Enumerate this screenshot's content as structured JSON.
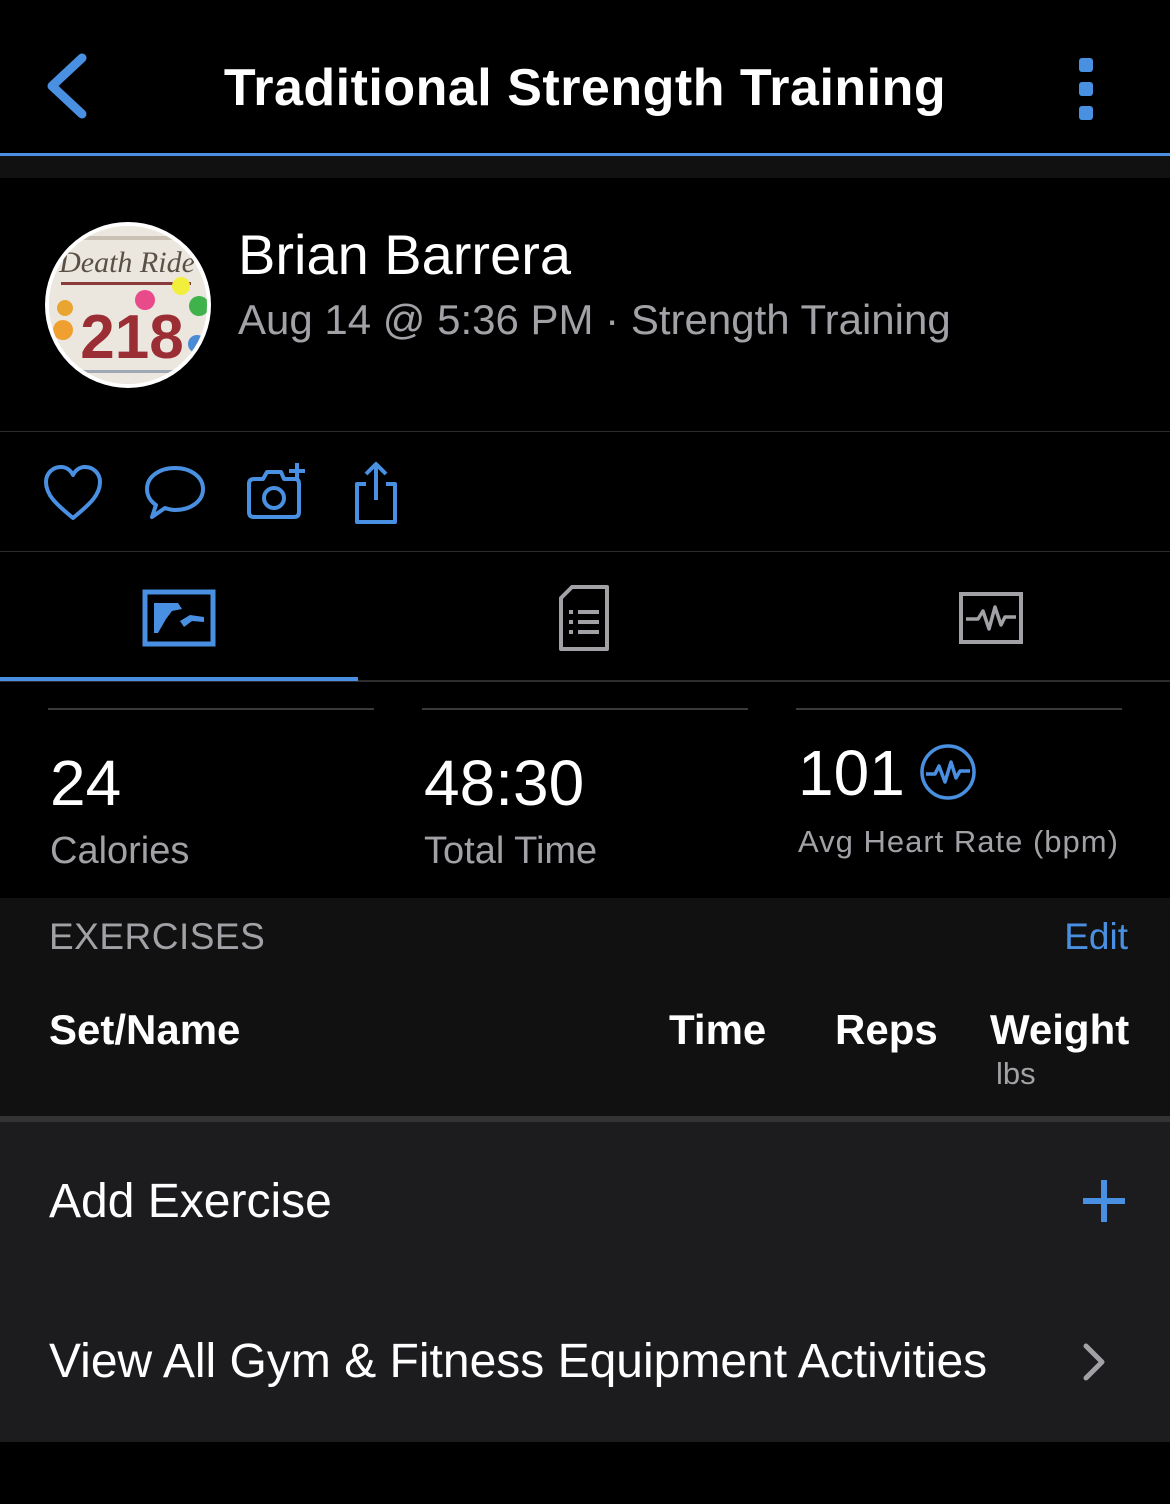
{
  "header": {
    "title": "Traditional Strength Training"
  },
  "profile": {
    "name": "Brian Barrera",
    "meta": "Aug 14 @ 5:36 PM · Strength Training",
    "avatar_text": {
      "top": "Death Ride",
      "number": "218"
    }
  },
  "actions": [
    "like-icon",
    "comment-icon",
    "add-photo-icon",
    "share-icon"
  ],
  "tabs": [
    "stats-tab-icon",
    "details-tab-icon",
    "chart-tab-icon"
  ],
  "stats": [
    {
      "value": "24",
      "label": "Calories"
    },
    {
      "value": "48:30",
      "label": "Total Time"
    },
    {
      "value": "101",
      "label": "Avg Heart Rate (bpm)"
    }
  ],
  "exercises": {
    "title": "EXERCISES",
    "edit_label": "Edit",
    "columns": {
      "set_name": "Set/Name",
      "time": "Time",
      "reps": "Reps",
      "weight": "Weight",
      "weight_unit": "lbs"
    }
  },
  "list": {
    "add_exercise": "Add Exercise",
    "view_all": "View All Gym & Fitness Equipment Activities"
  },
  "colors": {
    "accent": "#4a90e2",
    "background": "#000000",
    "secondary_text": "#a1a1a6"
  }
}
